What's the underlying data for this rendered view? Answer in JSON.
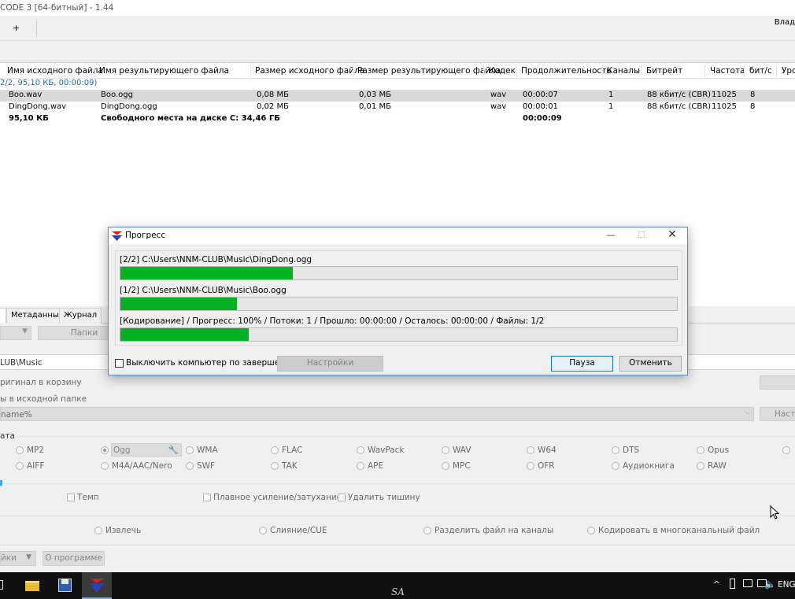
{
  "app": {
    "title": "CODE 3 [64-битный] - 1.44",
    "toolbar_plus": "+",
    "user_label": "Влад"
  },
  "table": {
    "headers": [
      "Имя исходного файла",
      "Имя результирующего файла",
      "Размер исходного файла",
      "Размер результирующего файла",
      "Кодек",
      "Продолжительность",
      "Каналы",
      "Битрейт",
      "Частота",
      "бит/с",
      "Уро"
    ],
    "summary": "2/2, 95,10 КБ, 00:00:09)",
    "rows": [
      {
        "src": "Boo.wav",
        "dst": "Boo.ogg",
        "src_size": "0,08 МБ",
        "dst_size": "0,03 МБ",
        "codec": "wav",
        "duration": "00:00:07",
        "channels": "1",
        "bitrate": "88 кбит/с (CBR)",
        "freq": "11025",
        "bits": "8"
      },
      {
        "src": "DingDong.wav",
        "dst": "DingDong.ogg",
        "src_size": "0,02 МБ",
        "dst_size": "0,01 МБ",
        "codec": "wav",
        "duration": "00:00:01",
        "channels": "1",
        "bitrate": "88 кбит/с (CBR)",
        "freq": "11025",
        "bits": "8"
      }
    ],
    "totals": {
      "size": "95,10 КБ",
      "free": "Свободного места на диске С: 34,46 ГБ",
      "duration": "00:00:09"
    }
  },
  "lower": {
    "tabs": [
      "Метаданные",
      "Журнал"
    ],
    "folders_button": "Папки",
    "path": "LUB\\Music",
    "recycle_label": "ригинал в корзину",
    "source_folder_label": "ы в исходной папке",
    "name_template": "name%",
    "settings_short": "Настр",
    "format_group_label": "ата",
    "formats_row1": [
      "MP2",
      "Ogg",
      "WMA",
      "FLAC",
      "WavPack",
      "WAV",
      "W64",
      "DTS",
      "Opus"
    ],
    "formats_row2": [
      "AIFF",
      "M4A/AAC/Nero",
      "SWF",
      "TAK",
      "APE",
      "MPC",
      "OFR",
      "Аудиокнига",
      "RAW"
    ],
    "options": [
      "Темп",
      "Плавное усиление/затухание",
      "Удалить тишину"
    ],
    "modes": [
      "Извлечь",
      "Слияние/CUE",
      "Разделить файл на каналы",
      "Кодировать в многоканальный файл"
    ],
    "bottom_buttons": [
      "йки",
      "О программе"
    ]
  },
  "dialog": {
    "title": "Прогресс",
    "lines": [
      "[2/2] C:\\Users\\NNM-CLUB\\Music\\DingDong.ogg",
      "[1/2] C:\\Users\\NNM-CLUB\\Music\\Boo.ogg",
      "[Кодирование] / Прогресс: 100% / Потоки: 1 / Прошло: 00:00:00 / Осталось: 00:00:00 / Файлы: 1/2"
    ],
    "progress": [
      0.31,
      0.21,
      0.23
    ],
    "shutdown_label": "Выключить компьютер по завершении",
    "settings_button": "Настройки",
    "pause_button": "Пауза",
    "cancel_button": "Отменить"
  },
  "taskbar": {
    "center_text": "SA",
    "lang": "ENG",
    "tray_chevron": "^"
  },
  "colors": {
    "progress_fill": "#06b025",
    "selected_row": "#d9d9d9",
    "summary_text": "#1a6bb8",
    "dialog_border": "#4f8fd0"
  }
}
